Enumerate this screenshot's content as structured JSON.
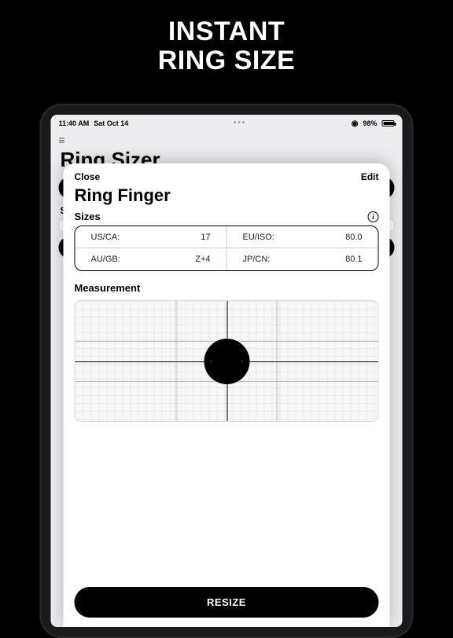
{
  "promo": {
    "line1": "INSTANT",
    "line2": "RING SIZE"
  },
  "status": {
    "time": "11:40 AM",
    "date": "Sat Oct 14",
    "battery": "98%"
  },
  "background": {
    "title": "Ring Sizer",
    "save_label": "Save"
  },
  "modal": {
    "close_label": "Close",
    "edit_label": "Edit",
    "title": "Ring Finger",
    "sizes_label": "Sizes",
    "measurement_label": "Measurement",
    "resize_label": "RESIZE",
    "sizes": [
      {
        "label": "US/CA:",
        "value": "17"
      },
      {
        "label": "EU/ISO:",
        "value": "80.0"
      },
      {
        "label": "AU/GB:",
        "value": "Z+4"
      },
      {
        "label": "JP/CN:",
        "value": "80.1"
      }
    ]
  }
}
